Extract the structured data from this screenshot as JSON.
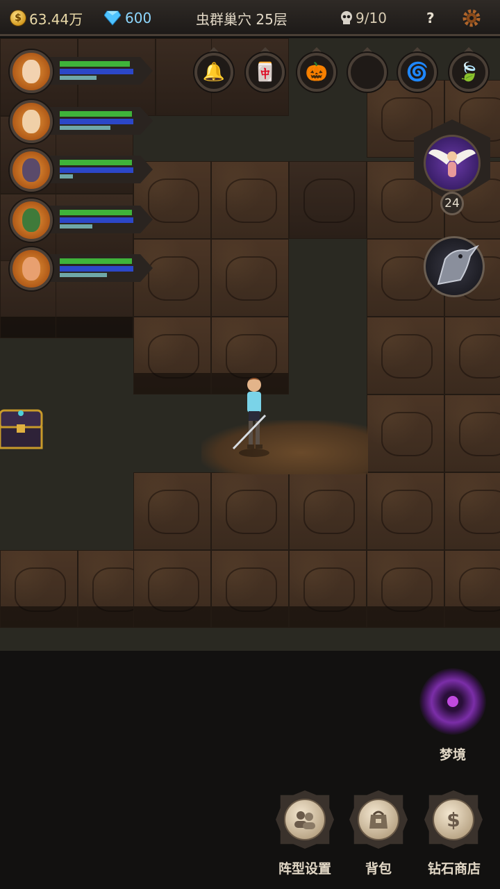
{
  "topbar": {
    "gold": "63.44万",
    "gold_icon": "gold-coin-icon",
    "gems": "600",
    "gem_icon": "diamond-icon",
    "location": "虫群巢穴 25层",
    "kills": "9/10",
    "kills_icon": "skull-icon",
    "help": "?",
    "settings_icon": "gear-icon"
  },
  "party": [
    {
      "name": "hero-1",
      "hp": 0.86,
      "mp": 0.9,
      "xp": 0.45,
      "color": "#c94a3a"
    },
    {
      "name": "hero-2",
      "hp": 0.88,
      "mp": 0.9,
      "xp": 0.62,
      "color": "#d9b07a"
    },
    {
      "name": "hero-3",
      "hp": 0.88,
      "mp": 0.9,
      "xp": 0.16,
      "color": "#5a4a7a"
    },
    {
      "name": "hero-4",
      "hp": 0.88,
      "mp": 0.9,
      "xp": 0.4,
      "color": "#3f7a3a"
    },
    {
      "name": "hero-5",
      "hp": 0.88,
      "mp": 0.9,
      "xp": 0.58,
      "color": "#d85a2a"
    }
  ],
  "slots": [
    {
      "name": "bell-slot",
      "icon": "🔔"
    },
    {
      "name": "scroll-slot",
      "icon": "🀄"
    },
    {
      "name": "pumpkin-slot",
      "icon": "🎃"
    },
    {
      "name": "empty-slot",
      "icon": ""
    },
    {
      "name": "orb-slot",
      "icon": "🌀"
    },
    {
      "name": "leaf-slot",
      "icon": "🍃"
    }
  ],
  "angel": {
    "level": "24"
  },
  "bottom": {
    "dream_label": "梦境",
    "formation_label": "阵型设置",
    "bag_label": "背包",
    "shop_label": "钻石商店",
    "shop_icon": "$"
  },
  "colors": {
    "hp": "#3fb33a",
    "mp": "#2c47c8",
    "xp": "#6fa7a8",
    "accent": "#d9cdb4"
  }
}
